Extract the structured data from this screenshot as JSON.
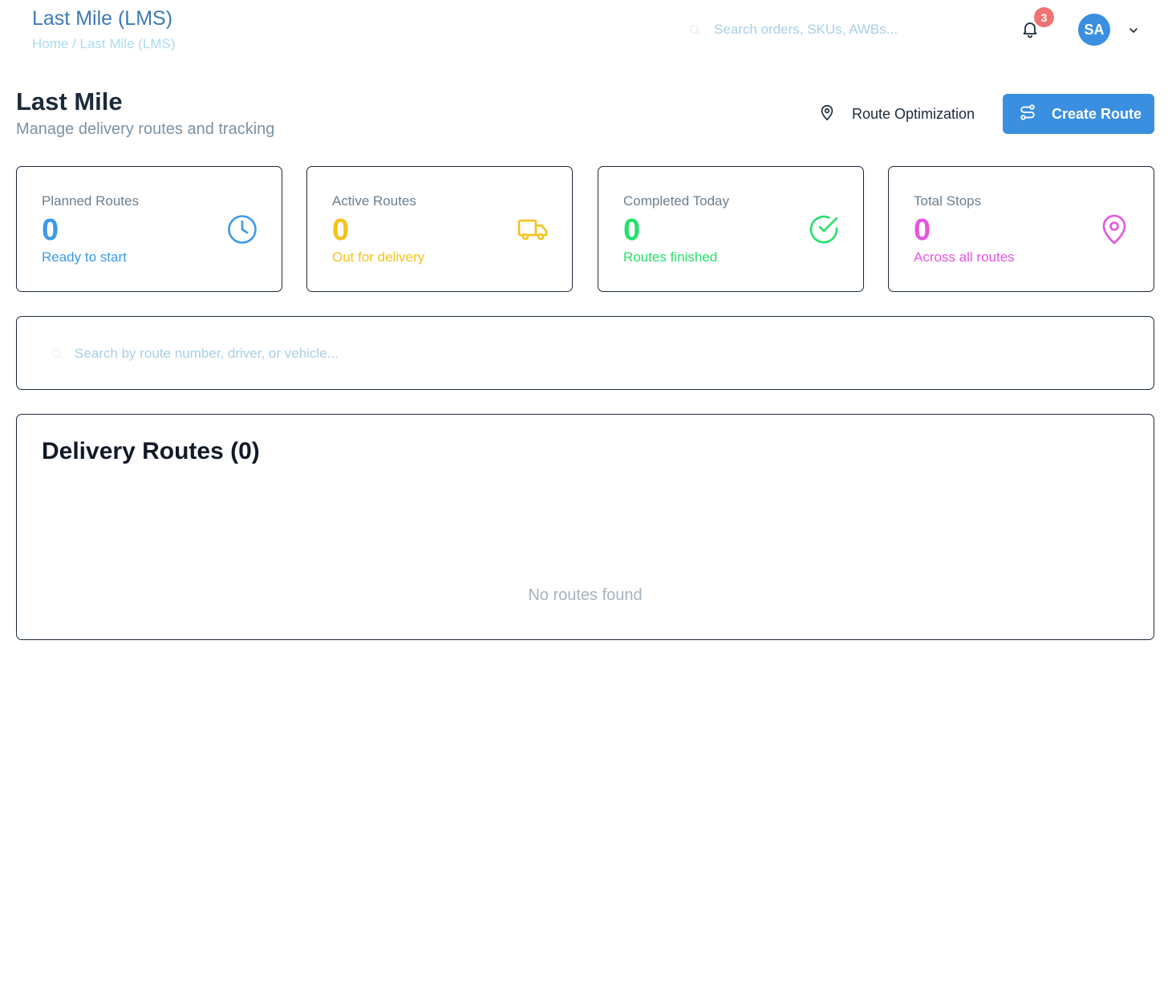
{
  "header": {
    "app_title": "Last Mile (LMS)",
    "breadcrumb": "Home / Last Mile (LMS)",
    "search_placeholder": "Search orders, SKUs, AWBs...",
    "notification_count": "3",
    "avatar_initials": "SA"
  },
  "page": {
    "title": "Last Mile",
    "subtitle": "Manage delivery routes and tracking",
    "route_optimization_label": "Route Optimization",
    "create_route_label": "Create Route"
  },
  "stats": [
    {
      "label": "Planned Routes",
      "value": "0",
      "sub": "Ready to start",
      "color": "#3b9ae8",
      "icon": "clock-icon"
    },
    {
      "label": "Active Routes",
      "value": "0",
      "sub": "Out for delivery",
      "color": "#f5c217",
      "icon": "truck-icon"
    },
    {
      "label": "Completed Today",
      "value": "0",
      "sub": "Routes finished",
      "color": "#26e06a",
      "icon": "check-circle-icon"
    },
    {
      "label": "Total Stops",
      "value": "0",
      "sub": "Across all routes",
      "color": "#e456dd",
      "icon": "map-pin-icon"
    }
  ],
  "filter": {
    "search_placeholder": "Search by route number, driver, or vehicle..."
  },
  "routes": {
    "title": "Delivery Routes (0)",
    "empty_message": "No routes found"
  }
}
